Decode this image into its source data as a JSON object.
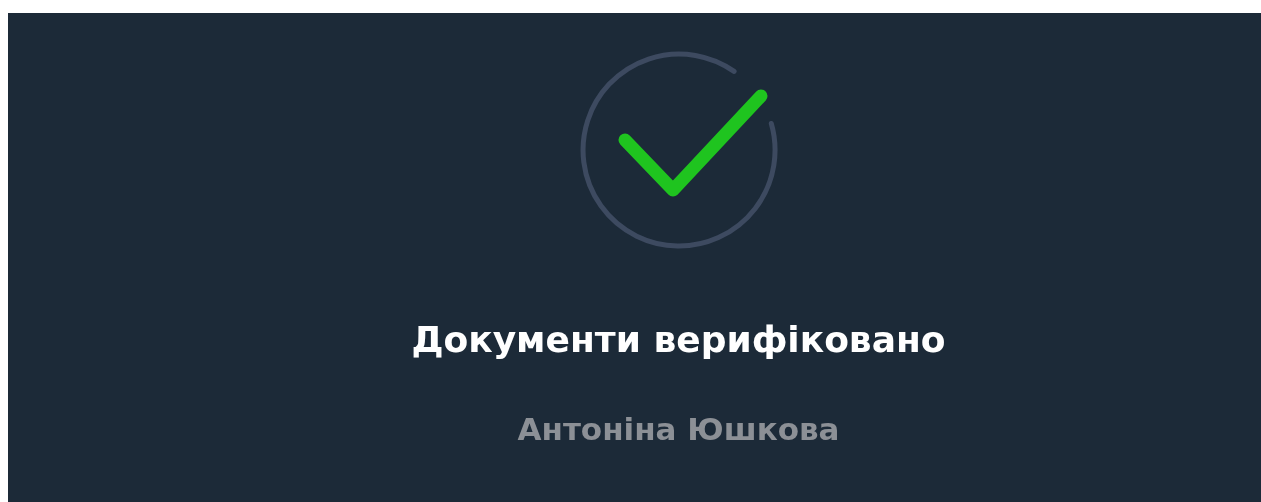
{
  "status": {
    "verified": true
  },
  "title": "Документи верифіковано",
  "name": "Антоніна Юшкова"
}
